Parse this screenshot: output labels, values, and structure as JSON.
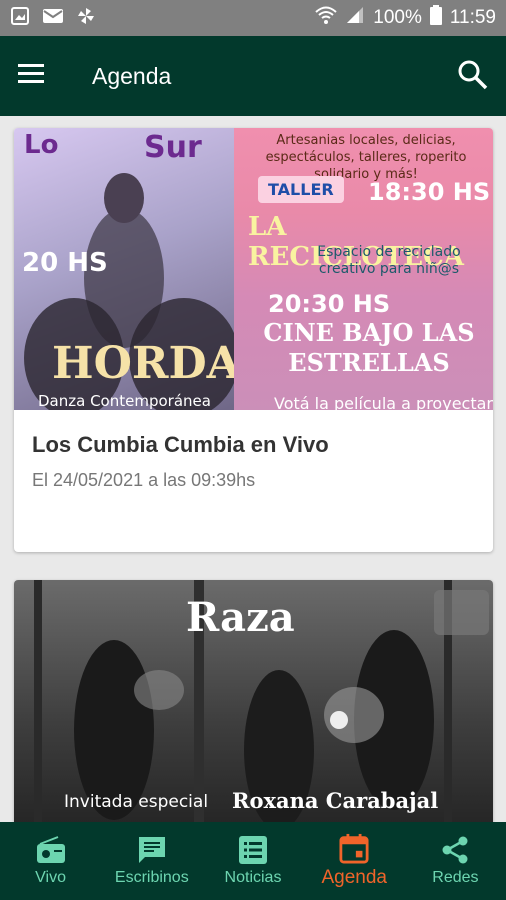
{
  "status_bar": {
    "battery": "100%",
    "time": "11:59"
  },
  "app_bar": {
    "title": "Agenda"
  },
  "cards": [
    {
      "poster_text": {
        "top_left": "Lo",
        "top_mid": "Sur",
        "top_right": "Artesanias locales, delicias, espectáculos, talleres, roperito solidario y más!",
        "taller_tag": "TALLER",
        "time1": "18:30 HS",
        "reci": "LA RECICLOTECA",
        "reci_sub": "Espacio de reciclado creativo para niñ@s",
        "time2": "20:30 HS",
        "cine": "CINE BAJO LAS ESTRELLAS",
        "vota": "Votá la película a proyectar",
        "left_time": "20 HS",
        "horda": "HORDA",
        "danza": "Danza Contemporánea"
      },
      "title": "Los Cumbia Cumbia en Vivo",
      "subtitle": "El 24/05/2021 a las 09:39hs"
    },
    {
      "poster_text": {
        "band": "Raza",
        "guest_label": "Invitada especial",
        "guest_name": "Roxana Carabajal"
      }
    }
  ],
  "bottom_nav": [
    {
      "label": "Vivo",
      "icon": "radio-icon",
      "active": false
    },
    {
      "label": "Escribinos",
      "icon": "message-icon",
      "active": false
    },
    {
      "label": "Noticias",
      "icon": "list-icon",
      "active": false
    },
    {
      "label": "Agenda",
      "icon": "calendar-icon",
      "active": true
    },
    {
      "label": "Redes",
      "icon": "share-icon",
      "active": false
    }
  ],
  "colors": {
    "primary_dark": "#02392c",
    "nav_inactive": "#6dd5b0",
    "nav_active": "#f0642a",
    "status_bar": "#808080"
  }
}
